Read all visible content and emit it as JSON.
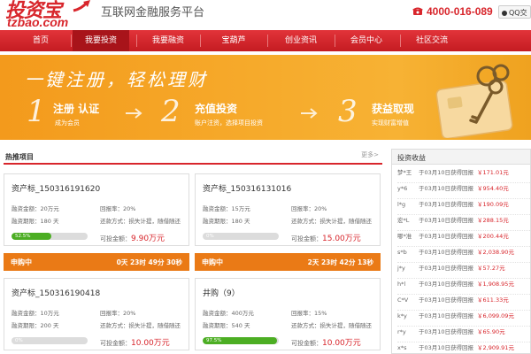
{
  "header": {
    "logo_cn": "投资宝",
    "logo_en": "tzbao.com",
    "slogan": "互联网金融服务平台",
    "phone": "4000-016-089",
    "qq_label": "QQ交"
  },
  "nav": {
    "items": [
      {
        "label": "首页"
      },
      {
        "label": "我要投资"
      },
      {
        "label": "我要融资"
      },
      {
        "label": "宝葫芦"
      },
      {
        "label": "创业资讯"
      },
      {
        "label": "会员中心"
      },
      {
        "label": "社区交流"
      }
    ],
    "active_index": 1,
    "color": "#d8262c"
  },
  "banner": {
    "title": "一键注册，轻松理财",
    "steps": [
      {
        "num": "1",
        "title": "注册 认证",
        "sub": "成为会员"
      },
      {
        "num": "2",
        "title": "充值投资",
        "sub": "账户注资，选择项目投资"
      },
      {
        "num": "3",
        "title": "获益取现",
        "sub": "实现财富增值"
      }
    ],
    "color": "#f6a92a"
  },
  "hot": {
    "title": "热推项目",
    "more": "更多>"
  },
  "products": [
    {
      "name": "资产标_150316191620",
      "amount": "融资金额：20万元",
      "period": "融资期限：180 天",
      "rate": "回报率：20%",
      "repay": "还款方式：损失计提，随借随还",
      "progress_text": "52.5%",
      "progress": 0.525,
      "bid_label": "可投金额：",
      "bid_value": "9.90万元"
    },
    {
      "name": "资产标_150316131016",
      "amount": "融资金额：15万元",
      "period": "融资期限：180 天",
      "rate": "回报率：20%",
      "repay": "还款方式：损失计提，随借随还",
      "progress_text": "0%",
      "progress": 0.0,
      "bid_label": "可投金额：",
      "bid_value": "15.00万元"
    },
    {
      "name": "资产标_150316190418",
      "amount": "融资金额：10万元",
      "period": "融资期限：200 天",
      "rate": "回报率：20%",
      "repay": "还款方式：损失计提，随借随还",
      "progress_text": "0%",
      "progress": 0.0,
      "bid_label": "可投金额：",
      "bid_value": "10.00万元"
    },
    {
      "name": "井购（9）",
      "amount": "融资金额：400万元",
      "period": "融资期限：540 天",
      "rate": "回报率：15%",
      "repay": "还款方式：损失计提，随借随还",
      "progress_text": "97.5%",
      "progress": 0.975,
      "bid_label": "可投金额：",
      "bid_value": "10.00万元"
    }
  ],
  "buybars": [
    {
      "label": "申购中",
      "time": "0天 23时 49分 30秒"
    },
    {
      "label": "申购中",
      "time": "2天 23时 42分 13秒"
    }
  ],
  "sidebar": {
    "title": "投资收益",
    "rows": [
      {
        "user": "梦*王",
        "date": "于03月10日",
        "type": "获得回报",
        "value": "￥171.01元"
      },
      {
        "user": "y*6",
        "date": "于03月10日",
        "type": "获得回报",
        "value": "￥954.40元"
      },
      {
        "user": "l*g",
        "date": "于03月10日",
        "type": "获得回报",
        "value": "￥190.09元"
      },
      {
        "user": "宏*L",
        "date": "于03月10日",
        "type": "获得回报",
        "value": "￥288.15元"
      },
      {
        "user": "哪*准",
        "date": "于03月10日",
        "type": "获得回报",
        "value": "￥200.44元"
      },
      {
        "user": "s*b",
        "date": "于03月10日",
        "type": "获得回报",
        "value": "￥2,038.90元"
      },
      {
        "user": "j*y",
        "date": "于03月10日",
        "type": "获得回报",
        "value": "￥57.27元"
      },
      {
        "user": "h*l",
        "date": "于03月10日",
        "type": "获得回报",
        "value": "￥1,908.95元"
      },
      {
        "user": "C*V",
        "date": "于03月10日",
        "type": "获得回报",
        "value": "￥611.33元"
      },
      {
        "user": "k*y",
        "date": "于03月10日",
        "type": "获得回报",
        "value": "￥6,099.09元"
      },
      {
        "user": "r*y",
        "date": "于03月10日",
        "type": "获得回报",
        "value": "￥65.90元"
      },
      {
        "user": "x*s",
        "date": "于03月10日",
        "type": "获得回报",
        "value": "￥2,909.91元"
      }
    ]
  }
}
